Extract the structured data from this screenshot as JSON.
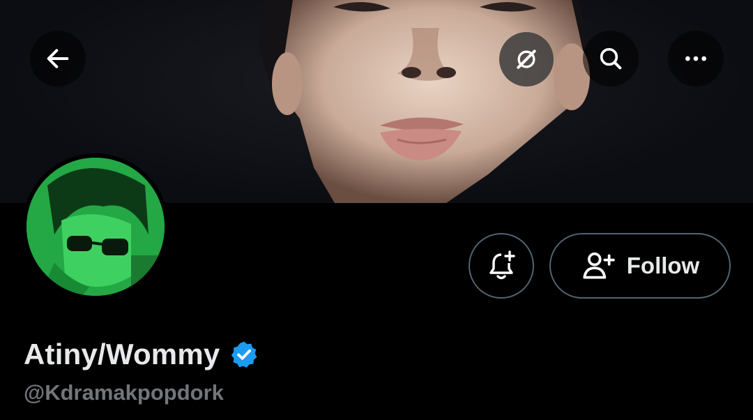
{
  "profile": {
    "display_name": "Atiny/Wommy",
    "handle": "@Kdramakpopdork",
    "verified": true
  },
  "header": {
    "back_icon": "arrow-left-icon",
    "grok_icon": "grok-icon",
    "search_icon": "search-icon",
    "more_icon": "more-horizontal-icon"
  },
  "actions": {
    "notify_icon": "bell-plus-icon",
    "follow_label": "Follow",
    "follow_icon": "person-plus-icon"
  },
  "colors": {
    "background": "#000000",
    "text_primary": "#e7e9ea",
    "text_secondary": "#71767b",
    "border": "#536471",
    "verified_blue": "#1d9bf0",
    "avatar_tint": "#1f9b3e"
  }
}
